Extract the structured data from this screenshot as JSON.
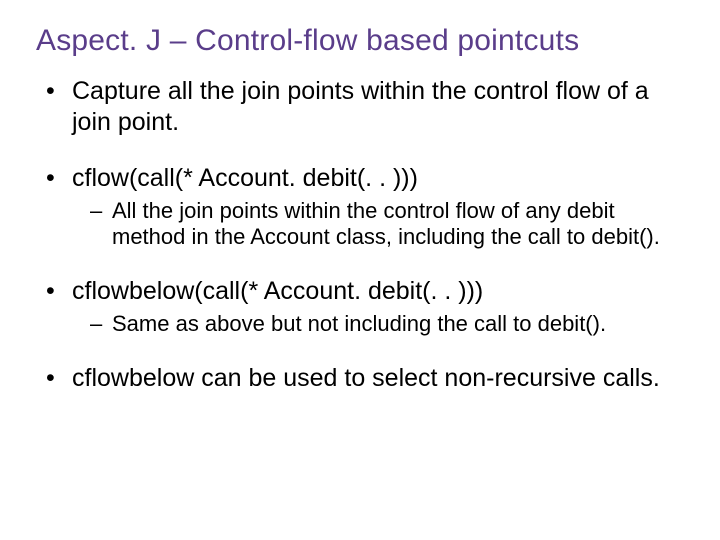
{
  "title": "Aspect. J – Control-flow based pointcuts",
  "bullets": [
    {
      "text": "Capture all the join points within the control flow of a join point.",
      "sub": []
    },
    {
      "text": "cflow(call(* Account. debit(. . )))",
      "sub": [
        "All the join points within the control flow of any debit method in the Account class, including the call to debit()."
      ]
    },
    {
      "text": "cflowbelow(call(* Account. debit(. . )))",
      "sub": [
        "Same as above but not including the call to debit()."
      ]
    },
    {
      "text": "cflowbelow can be used to select non-recursive calls.",
      "sub": []
    }
  ]
}
